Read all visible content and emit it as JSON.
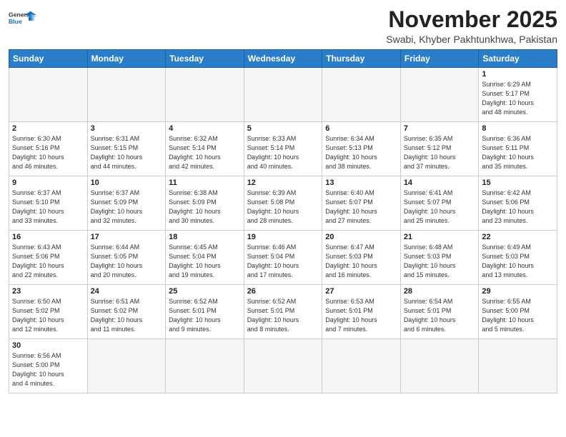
{
  "header": {
    "logo_general": "General",
    "logo_blue": "Blue",
    "month_title": "November 2025",
    "subtitle": "Swabi, Khyber Pakhtunkhwa, Pakistan"
  },
  "weekdays": [
    "Sunday",
    "Monday",
    "Tuesday",
    "Wednesday",
    "Thursday",
    "Friday",
    "Saturday"
  ],
  "weeks": [
    [
      {
        "day": "",
        "info": ""
      },
      {
        "day": "",
        "info": ""
      },
      {
        "day": "",
        "info": ""
      },
      {
        "day": "",
        "info": ""
      },
      {
        "day": "",
        "info": ""
      },
      {
        "day": "",
        "info": ""
      },
      {
        "day": "1",
        "info": "Sunrise: 6:29 AM\nSunset: 5:17 PM\nDaylight: 10 hours\nand 48 minutes."
      }
    ],
    [
      {
        "day": "2",
        "info": "Sunrise: 6:30 AM\nSunset: 5:16 PM\nDaylight: 10 hours\nand 46 minutes."
      },
      {
        "day": "3",
        "info": "Sunrise: 6:31 AM\nSunset: 5:15 PM\nDaylight: 10 hours\nand 44 minutes."
      },
      {
        "day": "4",
        "info": "Sunrise: 6:32 AM\nSunset: 5:14 PM\nDaylight: 10 hours\nand 42 minutes."
      },
      {
        "day": "5",
        "info": "Sunrise: 6:33 AM\nSunset: 5:14 PM\nDaylight: 10 hours\nand 40 minutes."
      },
      {
        "day": "6",
        "info": "Sunrise: 6:34 AM\nSunset: 5:13 PM\nDaylight: 10 hours\nand 38 minutes."
      },
      {
        "day": "7",
        "info": "Sunrise: 6:35 AM\nSunset: 5:12 PM\nDaylight: 10 hours\nand 37 minutes."
      },
      {
        "day": "8",
        "info": "Sunrise: 6:36 AM\nSunset: 5:11 PM\nDaylight: 10 hours\nand 35 minutes."
      }
    ],
    [
      {
        "day": "9",
        "info": "Sunrise: 6:37 AM\nSunset: 5:10 PM\nDaylight: 10 hours\nand 33 minutes."
      },
      {
        "day": "10",
        "info": "Sunrise: 6:37 AM\nSunset: 5:09 PM\nDaylight: 10 hours\nand 32 minutes."
      },
      {
        "day": "11",
        "info": "Sunrise: 6:38 AM\nSunset: 5:09 PM\nDaylight: 10 hours\nand 30 minutes."
      },
      {
        "day": "12",
        "info": "Sunrise: 6:39 AM\nSunset: 5:08 PM\nDaylight: 10 hours\nand 28 minutes."
      },
      {
        "day": "13",
        "info": "Sunrise: 6:40 AM\nSunset: 5:07 PM\nDaylight: 10 hours\nand 27 minutes."
      },
      {
        "day": "14",
        "info": "Sunrise: 6:41 AM\nSunset: 5:07 PM\nDaylight: 10 hours\nand 25 minutes."
      },
      {
        "day": "15",
        "info": "Sunrise: 6:42 AM\nSunset: 5:06 PM\nDaylight: 10 hours\nand 23 minutes."
      }
    ],
    [
      {
        "day": "16",
        "info": "Sunrise: 6:43 AM\nSunset: 5:06 PM\nDaylight: 10 hours\nand 22 minutes."
      },
      {
        "day": "17",
        "info": "Sunrise: 6:44 AM\nSunset: 5:05 PM\nDaylight: 10 hours\nand 20 minutes."
      },
      {
        "day": "18",
        "info": "Sunrise: 6:45 AM\nSunset: 5:04 PM\nDaylight: 10 hours\nand 19 minutes."
      },
      {
        "day": "19",
        "info": "Sunrise: 6:46 AM\nSunset: 5:04 PM\nDaylight: 10 hours\nand 17 minutes."
      },
      {
        "day": "20",
        "info": "Sunrise: 6:47 AM\nSunset: 5:03 PM\nDaylight: 10 hours\nand 16 minutes."
      },
      {
        "day": "21",
        "info": "Sunrise: 6:48 AM\nSunset: 5:03 PM\nDaylight: 10 hours\nand 15 minutes."
      },
      {
        "day": "22",
        "info": "Sunrise: 6:49 AM\nSunset: 5:03 PM\nDaylight: 10 hours\nand 13 minutes."
      }
    ],
    [
      {
        "day": "23",
        "info": "Sunrise: 6:50 AM\nSunset: 5:02 PM\nDaylight: 10 hours\nand 12 minutes."
      },
      {
        "day": "24",
        "info": "Sunrise: 6:51 AM\nSunset: 5:02 PM\nDaylight: 10 hours\nand 11 minutes."
      },
      {
        "day": "25",
        "info": "Sunrise: 6:52 AM\nSunset: 5:01 PM\nDaylight: 10 hours\nand 9 minutes."
      },
      {
        "day": "26",
        "info": "Sunrise: 6:52 AM\nSunset: 5:01 PM\nDaylight: 10 hours\nand 8 minutes."
      },
      {
        "day": "27",
        "info": "Sunrise: 6:53 AM\nSunset: 5:01 PM\nDaylight: 10 hours\nand 7 minutes."
      },
      {
        "day": "28",
        "info": "Sunrise: 6:54 AM\nSunset: 5:01 PM\nDaylight: 10 hours\nand 6 minutes."
      },
      {
        "day": "29",
        "info": "Sunrise: 6:55 AM\nSunset: 5:00 PM\nDaylight: 10 hours\nand 5 minutes."
      }
    ],
    [
      {
        "day": "30",
        "info": "Sunrise: 6:56 AM\nSunset: 5:00 PM\nDaylight: 10 hours\nand 4 minutes."
      },
      {
        "day": "",
        "info": ""
      },
      {
        "day": "",
        "info": ""
      },
      {
        "day": "",
        "info": ""
      },
      {
        "day": "",
        "info": ""
      },
      {
        "day": "",
        "info": ""
      },
      {
        "day": "",
        "info": ""
      }
    ]
  ]
}
